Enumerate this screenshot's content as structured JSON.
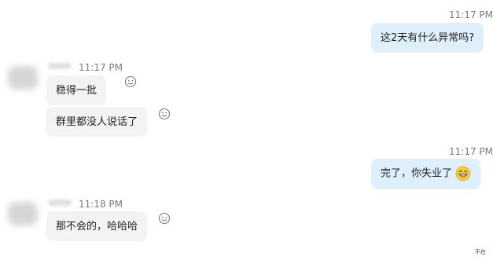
{
  "messages": [
    {
      "direction": "out",
      "time": "11:17 PM",
      "text": "这2天有什么异常吗?"
    },
    {
      "direction": "in",
      "time": "11:17 PM",
      "texts": [
        "稳得一批",
        "群里都没人说话了"
      ]
    },
    {
      "direction": "out",
      "time": "11:17 PM",
      "text": "完了，你失业了",
      "emoji": "grinning-sweat-face-icon"
    },
    {
      "direction": "in",
      "time": "11:18 PM",
      "texts": [
        "那不会的，哈哈哈"
      ]
    }
  ],
  "footer_note": "不在",
  "colors": {
    "outgoing_bubble": "#dff0fc",
    "incoming_bubble": "#f3f3f5",
    "timestamp": "#7a7a7a",
    "emoji_yellow": "#f5c94a"
  }
}
